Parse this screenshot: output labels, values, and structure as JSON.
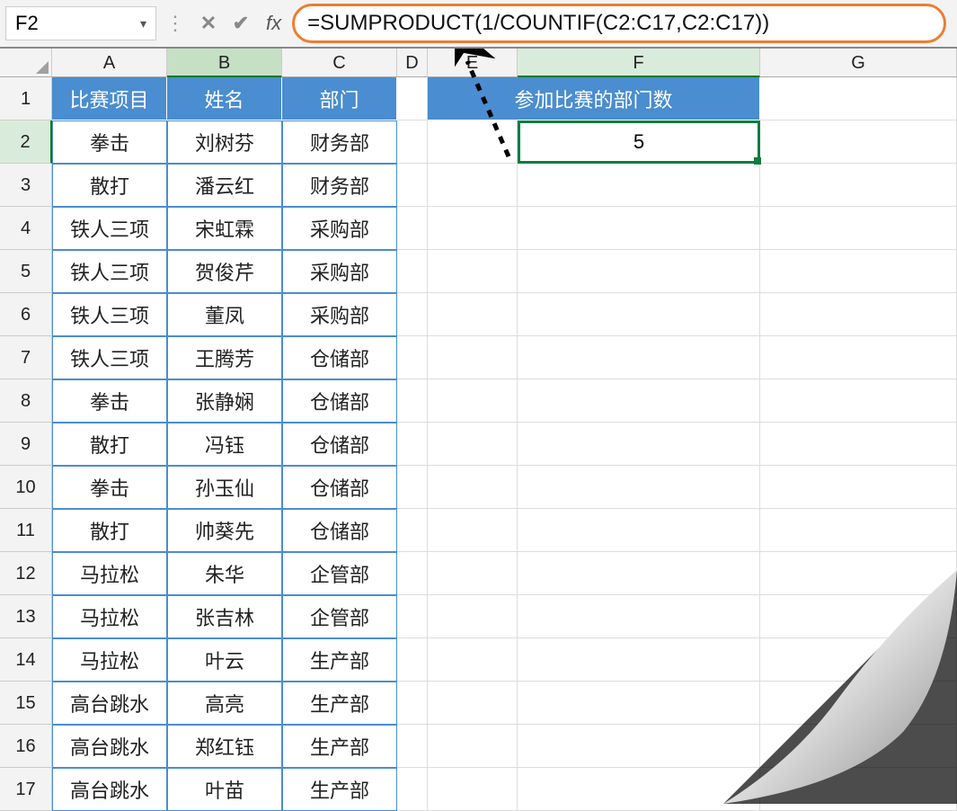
{
  "name_box": "F2",
  "formula": "=SUMPRODUCT(1/COUNTIF(C2:C17,C2:C17))",
  "fx_label": "fx",
  "columns": [
    "A",
    "B",
    "C",
    "D",
    "E",
    "F",
    "G"
  ],
  "row_numbers": [
    "1",
    "2",
    "3",
    "4",
    "5",
    "6",
    "7",
    "8",
    "9",
    "10",
    "11",
    "12",
    "13",
    "14",
    "15",
    "16",
    "17"
  ],
  "table1": {
    "headers": [
      "比赛项目",
      "姓名",
      "部门"
    ],
    "rows": [
      [
        "拳击",
        "刘树芬",
        "财务部"
      ],
      [
        "散打",
        "潘云红",
        "财务部"
      ],
      [
        "铁人三项",
        "宋虹霖",
        "采购部"
      ],
      [
        "铁人三项",
        "贺俊芹",
        "采购部"
      ],
      [
        "铁人三项",
        "董凤",
        "采购部"
      ],
      [
        "铁人三项",
        "王腾芳",
        "仓储部"
      ],
      [
        "拳击",
        "张静娴",
        "仓储部"
      ],
      [
        "散打",
        "冯钰",
        "仓储部"
      ],
      [
        "拳击",
        "孙玉仙",
        "仓储部"
      ],
      [
        "散打",
        "帅葵先",
        "仓储部"
      ],
      [
        "马拉松",
        "朱华",
        "企管部"
      ],
      [
        "马拉松",
        "张吉林",
        "企管部"
      ],
      [
        "马拉松",
        "叶云",
        "生产部"
      ],
      [
        "高台跳水",
        "高亮",
        "生产部"
      ],
      [
        "高台跳水",
        "郑红钰",
        "生产部"
      ],
      [
        "高台跳水",
        "叶苗",
        "生产部"
      ]
    ]
  },
  "table2": {
    "header": "参加比赛的部门数",
    "value": "5"
  },
  "selected_cell": "F2",
  "highlighted_column": "B",
  "chart_data": null
}
